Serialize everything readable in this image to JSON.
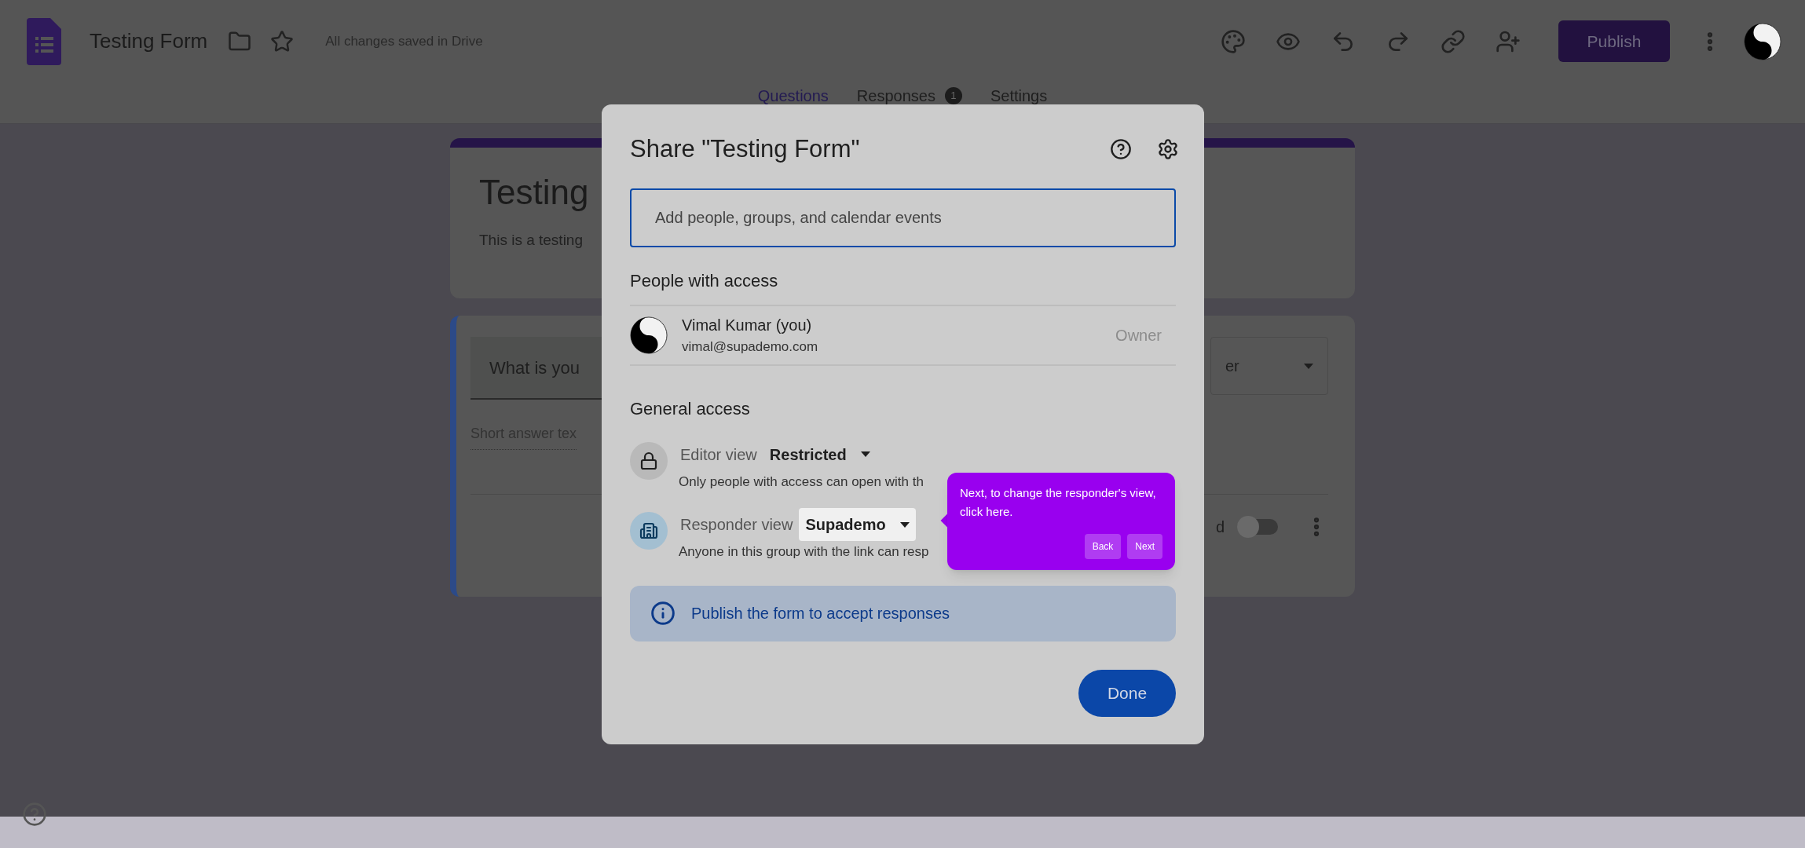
{
  "header": {
    "title": "Testing Form",
    "save_status": "All changes saved in Drive",
    "publish_button": "Publish"
  },
  "tabs": [
    {
      "label": "Questions",
      "selected": true
    },
    {
      "label": "Responses",
      "selected": false,
      "badge": "1"
    },
    {
      "label": "Settings",
      "selected": false
    }
  ],
  "form": {
    "title": "Testing",
    "description": "This is a testing",
    "question": {
      "title": "What is you",
      "answer_hint": "Short answer tex",
      "type_select": "er",
      "required_label": "d",
      "required": false
    }
  },
  "share_dialog": {
    "title": "Share \"Testing Form\"",
    "add_field": {
      "placeholder": "Add people, groups, and calendar events"
    },
    "people_heading": "People with access",
    "people": [
      {
        "name": "Vimal Kumar (you)",
        "email": "vimal@supademo.com",
        "role": "Owner"
      }
    ],
    "general_heading": "General access",
    "access": [
      {
        "kind": "restricted",
        "label": "Editor view",
        "value": "Restricted",
        "highlighted": false,
        "description": "Only people with access can open with th"
      },
      {
        "kind": "group",
        "label": "Responder view",
        "value": "Supademo",
        "highlighted": true,
        "description": "Anyone in this group with the link can resp"
      }
    ],
    "notice": "Publish the form to accept responses",
    "done_button": "Done"
  },
  "tour_tooltip": {
    "text": "Next, to change the responder's view, click here.",
    "back_button": "Back",
    "next_button": "Next"
  }
}
